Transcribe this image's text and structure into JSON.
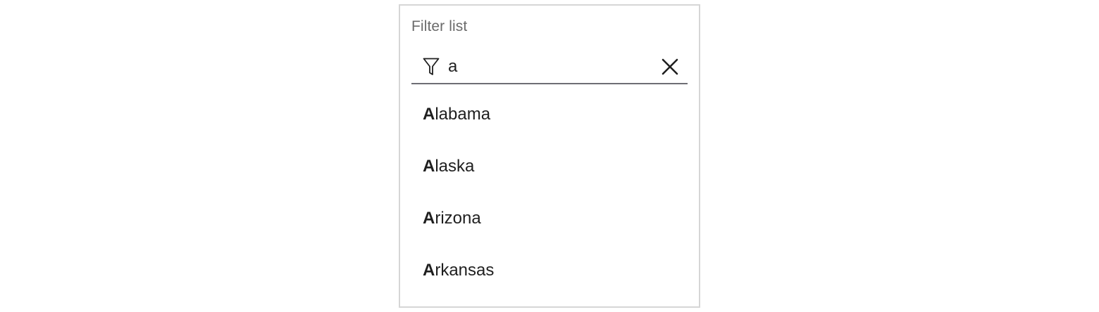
{
  "filter": {
    "label": "Filter list",
    "icon": "filter-icon",
    "query": "a",
    "placeholder": "",
    "clear_icon": "close-icon"
  },
  "results": [
    {
      "match": "A",
      "rest": "labama"
    },
    {
      "match": "A",
      "rest": "laska"
    },
    {
      "match": "A",
      "rest": "rizona"
    },
    {
      "match": "A",
      "rest": "rkansas"
    }
  ],
  "colors": {
    "panel_border": "#d6d6d6",
    "label_text": "#6b6b6b",
    "input_underline": "#6e6e74",
    "text": "#1f1f1f"
  }
}
